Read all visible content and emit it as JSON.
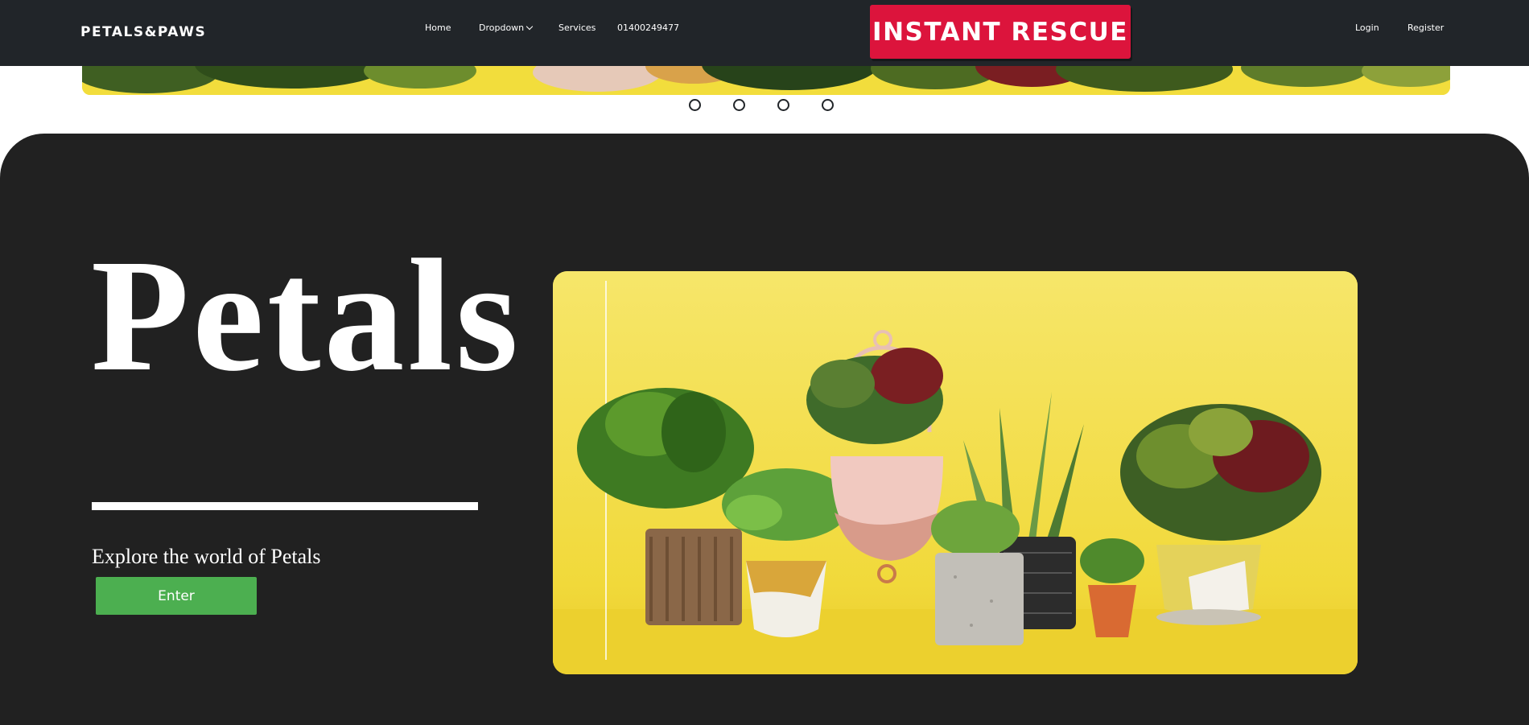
{
  "navbar": {
    "brand": "PETALS&PAWS",
    "links": {
      "home": "Home",
      "dropdown": "Dropdown",
      "services": "Services",
      "phone": "01400249477"
    },
    "rescue_button": "INSTANT RESCUE",
    "auth": {
      "login": "Login",
      "register": "Register"
    }
  },
  "carousel": {
    "indicator_count": 4
  },
  "hero": {
    "title": "Petals",
    "subtitle": "Explore the world of Petals",
    "enter_button": "Enter"
  },
  "colors": {
    "navbar_bg": "#212529",
    "hero_bg": "#212121",
    "rescue_red": "#dc143c",
    "enter_green": "#4caf50",
    "plant_backdrop": "#f4e04d"
  }
}
